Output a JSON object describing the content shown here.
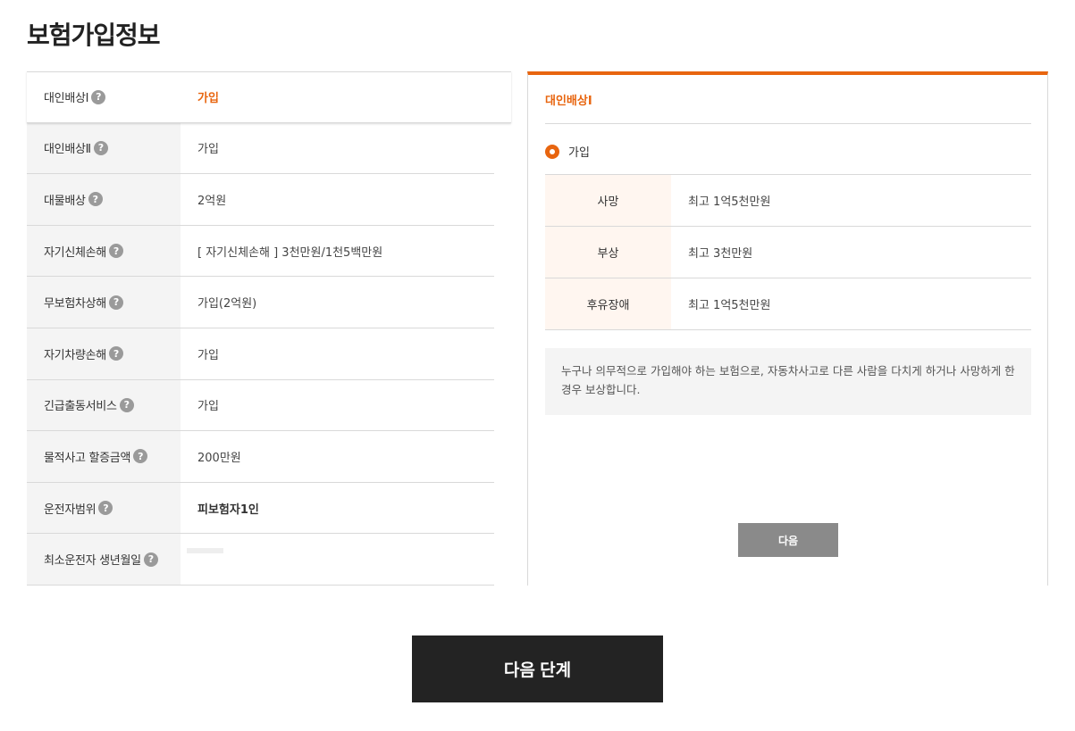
{
  "page": {
    "title": "보험가입정보"
  },
  "coverage": {
    "rows": [
      {
        "label": "대인배상Ⅰ",
        "value": "가입"
      },
      {
        "label": "대인배상Ⅱ",
        "value": "가입"
      },
      {
        "label": "대물배상",
        "value": "2억원"
      },
      {
        "label": "자기신체손해",
        "value": "[ 자기신체손해 ] 3천만원/1천5백만원"
      },
      {
        "label": "무보험차상해",
        "value": "가입(2억원)"
      },
      {
        "label": "자기차량손해",
        "value": "가입"
      },
      {
        "label": "긴급출동서비스",
        "value": "가입"
      },
      {
        "label": "물적사고 할증금액",
        "value": "200만원"
      },
      {
        "label": "운전자범위",
        "value": "피보험자1인"
      },
      {
        "label": "최소운전자 생년월일",
        "value": ""
      }
    ],
    "help_glyph": "?"
  },
  "detail": {
    "title": "대인배상Ⅰ",
    "option_label": "가입",
    "benefits": [
      {
        "label": "사망",
        "value": "최고 1억5천만원"
      },
      {
        "label": "부상",
        "value": "최고 3천만원"
      },
      {
        "label": "후유장애",
        "value": "최고 1억5천만원"
      }
    ],
    "notice": "누구나 의무적으로 가입해야 하는 보험으로, 자동차사고로 다른 사람을 다치게 하거나 사망하게 한 경우 보상합니다.",
    "next_label": "다음"
  },
  "footer": {
    "next_step_label": "다음 단계"
  },
  "colors": {
    "accent": "#e8650f",
    "dark_button": "#232323",
    "gray_button": "#8a8a8a"
  },
  "icons": {
    "help": "help-icon",
    "radio": "radio-selected-icon"
  }
}
